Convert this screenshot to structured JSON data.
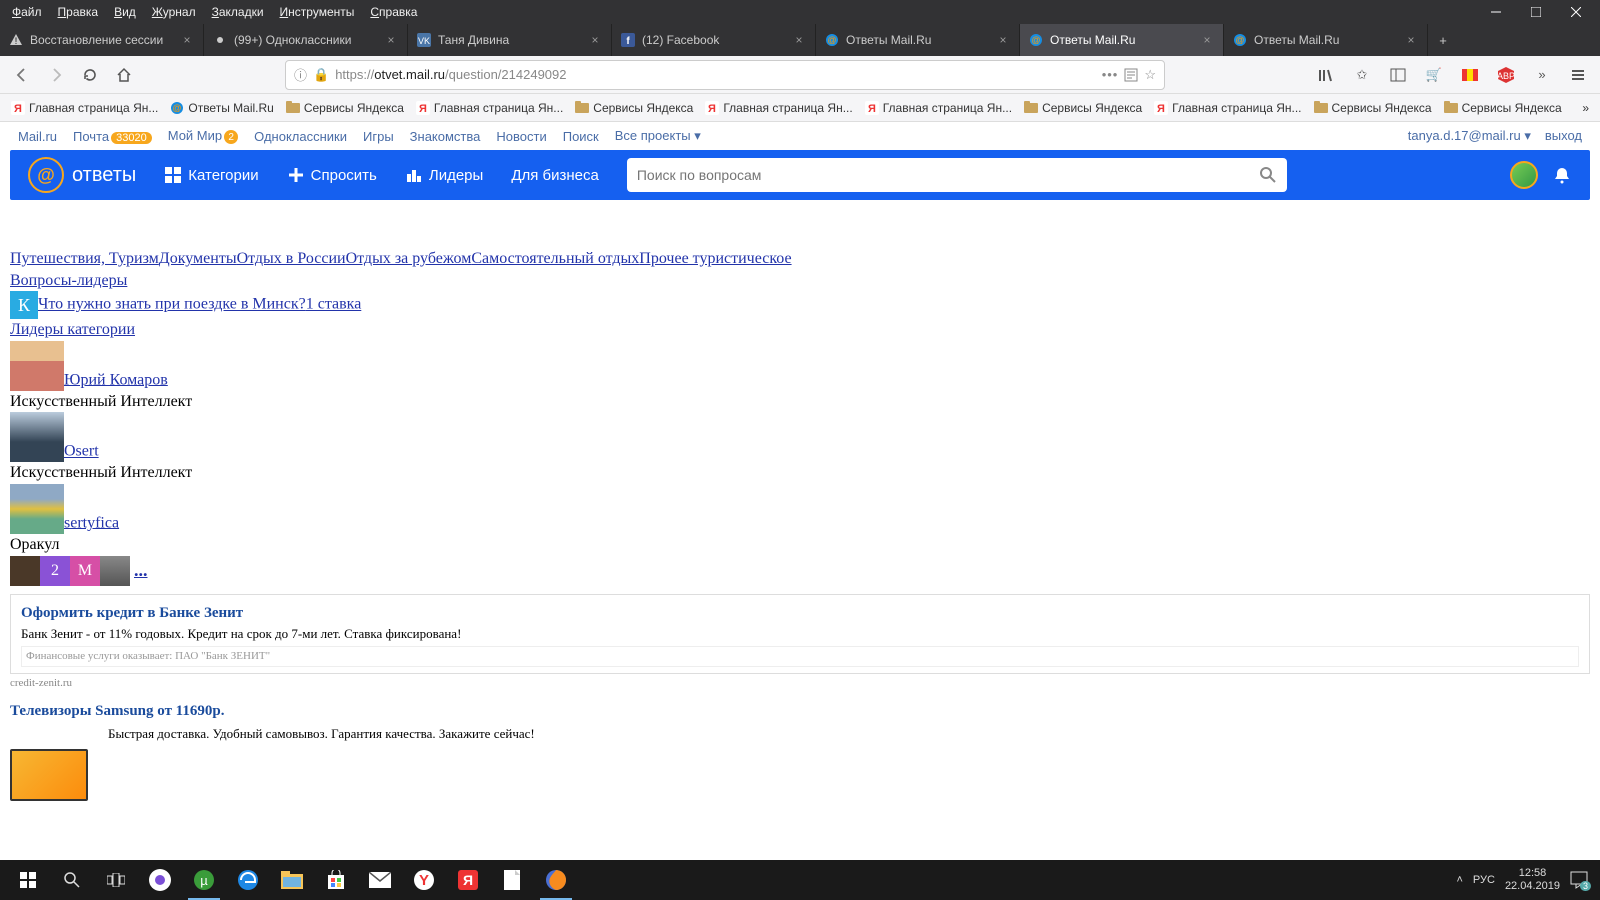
{
  "menubar": [
    "Файл",
    "Правка",
    "Вид",
    "Журнал",
    "Закладки",
    "Инструменты",
    "Справка"
  ],
  "tabs": [
    {
      "title": "Восстановление сессии",
      "icon": "warning"
    },
    {
      "title": "(99+) Одноклассники",
      "icon": "dot"
    },
    {
      "title": "Таня Дивина",
      "icon": "vk"
    },
    {
      "title": "(12) Facebook",
      "icon": "fb"
    },
    {
      "title": "Ответы Mail.Ru",
      "icon": "mail"
    },
    {
      "title": "Ответы Mail.Ru",
      "icon": "mail",
      "active": true
    },
    {
      "title": "Ответы Mail.Ru",
      "icon": "mail"
    }
  ],
  "url": {
    "proto": "https://",
    "host": "otvet.mail.ru",
    "path": "/question/214249092"
  },
  "bookmarks": [
    {
      "t": "Главная страница Ян...",
      "i": "ya"
    },
    {
      "t": "Ответы Mail.Ru",
      "i": "mail"
    },
    {
      "t": "Сервисы Яндекса",
      "i": "folder"
    },
    {
      "t": "Главная страница Ян...",
      "i": "ya"
    },
    {
      "t": "Сервисы Яндекса",
      "i": "folder"
    },
    {
      "t": "Главная страница Ян...",
      "i": "ya"
    },
    {
      "t": "Главная страница Ян...",
      "i": "ya"
    },
    {
      "t": "Сервисы Яндекса",
      "i": "folder"
    },
    {
      "t": "Главная страница Ян...",
      "i": "ya"
    },
    {
      "t": "Сервисы Яндекса",
      "i": "folder"
    },
    {
      "t": "Сервисы Яндекса",
      "i": "folder"
    }
  ],
  "mailnav": {
    "items": [
      "Mail.ru",
      "Почта",
      "Мой Мир",
      "Одноклассники",
      "Игры",
      "Знакомства",
      "Новости",
      "Поиск",
      "Все проекты"
    ],
    "mail_badge": "33020",
    "mir_badge": "2",
    "user": "tanya.d.17@mail.ru",
    "logout": "выход"
  },
  "bluebar": {
    "logo": "ответы",
    "nav": [
      "Категории",
      "Спросить",
      "Лидеры",
      "Для бизнеса"
    ],
    "search_ph": "Поиск по вопросам"
  },
  "page": {
    "crumbs": [
      "Путешествия, Туризм",
      "Документы",
      "Отдых в России",
      "Отдых за рубежом",
      "Самостоятельный отдых",
      "Прочее туристическое"
    ],
    "leaders_q": "Вопросы-лидеры",
    "q_badge": "К",
    "q_title": "Что нужно знать при поездке в Минск?",
    "q_bet": "1 ставка",
    "cat_leaders": "Лидеры категории",
    "leader1": {
      "name": "Юрий Комаров",
      "rank": "Искусственный Интеллект"
    },
    "leader2": {
      "name": "Osert",
      "rank": "Искусственный Интеллект"
    },
    "leader3": {
      "name": "sertyfica",
      "rank": "Оракул"
    },
    "dots": "...",
    "mini": [
      "",
      "2",
      "М",
      ""
    ],
    "ad1": {
      "title": "Оформить кредит в Банке Зенит",
      "text": "Банк Зенит - от 11% годовых. Кредит на срок до 7-ми лет. Ставка фиксирована!",
      "fine": "Финансовые услуги оказывает: ПАО \"Банк ЗЕНИТ\"",
      "url": "credit-zenit.ru"
    },
    "ad2": {
      "title": "Телевизоры Samsung от 11690р.",
      "text": "Быстрая доставка. Удобный самовывоз. Гарантия качества. Закажите сейчас!"
    }
  },
  "taskbar": {
    "lang": "РУС",
    "time": "12:58",
    "date": "22.04.2019",
    "notif": "3"
  }
}
